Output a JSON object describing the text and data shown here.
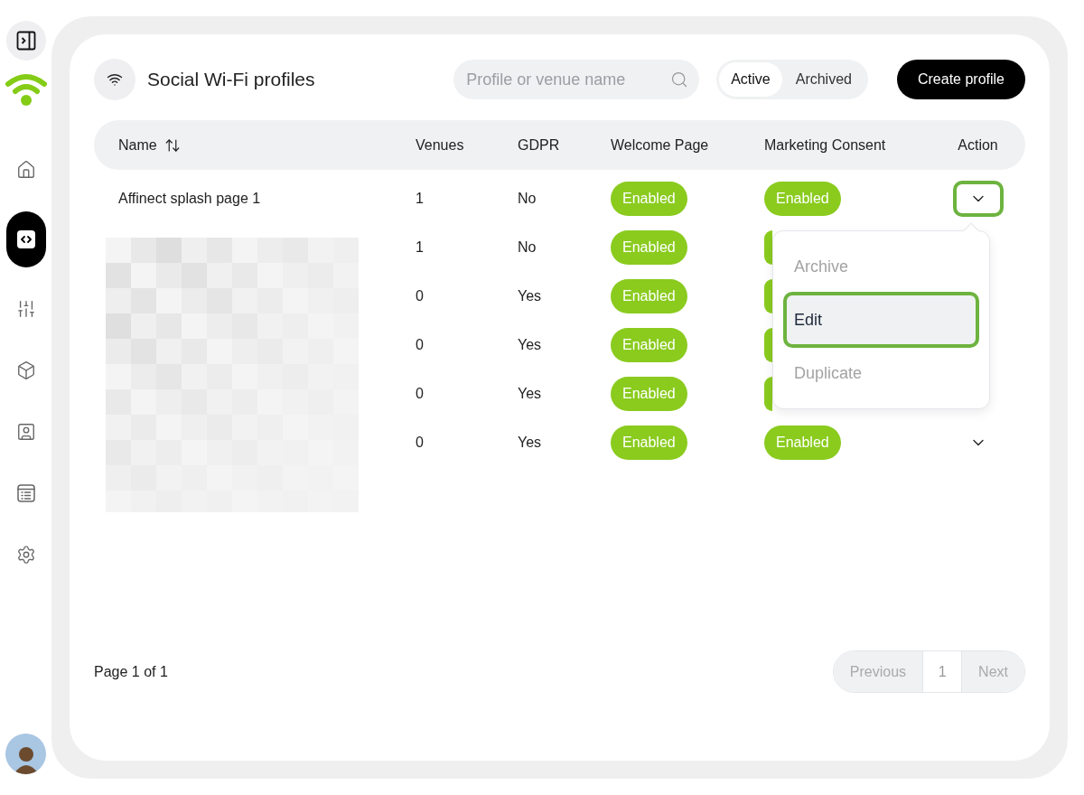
{
  "sidebar": {
    "items": [
      {
        "kind": "home",
        "selected": false
      },
      {
        "kind": "code",
        "selected": true
      },
      {
        "kind": "sliders",
        "selected": false
      },
      {
        "kind": "box",
        "selected": false
      },
      {
        "kind": "contact",
        "selected": false
      },
      {
        "kind": "list",
        "selected": false
      },
      {
        "kind": "settings",
        "selected": false
      }
    ]
  },
  "header": {
    "title": "Social Wi-Fi profiles",
    "search": {
      "placeholder": "Profile or venue name"
    },
    "tabs": [
      {
        "label": "Active",
        "selected": true
      },
      {
        "label": "Archived",
        "selected": false
      }
    ],
    "create_button": "Create profile"
  },
  "table": {
    "columns": [
      "Name",
      "Venues",
      "GDPR",
      "Welcome Page",
      "Marketing Consent",
      "Action"
    ],
    "rows": [
      {
        "name": "Affinect splash page 1",
        "venues": "1",
        "gdpr": "No",
        "welcome_page": "Enabled",
        "marketing_consent": "Enabled",
        "action": {
          "expanded": true
        }
      },
      {
        "venues": "1",
        "gdpr": "No",
        "welcome_page": "Enabled",
        "marketing_covered": true
      },
      {
        "venues": "0",
        "gdpr": "Yes",
        "welcome_page": "Enabled",
        "marketing_covered": true
      },
      {
        "venues": "0",
        "gdpr": "Yes",
        "welcome_page": "Enabled",
        "marketing_covered": true
      },
      {
        "venues": "0",
        "gdpr": "Yes",
        "welcome_page": "Enabled",
        "marketing_covered": true
      },
      {
        "venues": "0",
        "gdpr": "Yes",
        "welcome_page": "Enabled",
        "marketing_consent": "Enabled",
        "action": {
          "expanded": false
        }
      }
    ]
  },
  "action_menu": {
    "items": [
      {
        "label": "Archive",
        "selected": false,
        "disabled": true
      },
      {
        "label": "Edit",
        "selected": true,
        "disabled": false
      },
      {
        "label": "Duplicate",
        "selected": false,
        "disabled": true
      }
    ]
  },
  "footer": {
    "page_info": "Page 1 of 1",
    "pagination": [
      {
        "kind": "prev",
        "label": "Previous",
        "disabled": true
      },
      {
        "kind": "page",
        "label": "1",
        "selected": true
      },
      {
        "kind": "next",
        "label": "Next",
        "disabled": true
      }
    ]
  }
}
